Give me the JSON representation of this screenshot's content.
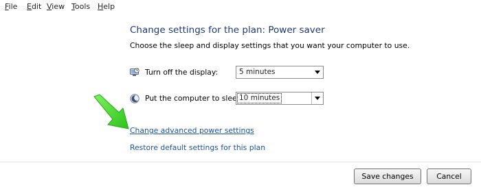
{
  "menu": [
    {
      "key": "F",
      "rest": "ile"
    },
    {
      "key": "E",
      "rest": "dit"
    },
    {
      "key": "V",
      "rest": "iew"
    },
    {
      "key": "T",
      "rest": "ools"
    },
    {
      "key": "H",
      "rest": "elp"
    }
  ],
  "title": "Change settings for the plan: Power saver",
  "subtitle": "Choose the sleep and display settings that you want your computer to use.",
  "display_setting": {
    "label": "Turn off the display:",
    "value": "5 minutes",
    "icon": "monitor-clock-icon"
  },
  "sleep_setting": {
    "label": "Put the computer to sleep:",
    "value": "10 minutes",
    "icon": "moon-sleep-icon"
  },
  "links": {
    "advanced": "Change advanced power settings",
    "restore": "Restore default settings for this plan"
  },
  "buttons": {
    "save": "Save changes",
    "cancel": "Cancel"
  },
  "colors": {
    "title": "#1e3a73",
    "link": "#1a52a3",
    "annotation_arrow": "#3ddc2a"
  },
  "annotation": {
    "icon": "green-pointer-arrow-icon"
  }
}
